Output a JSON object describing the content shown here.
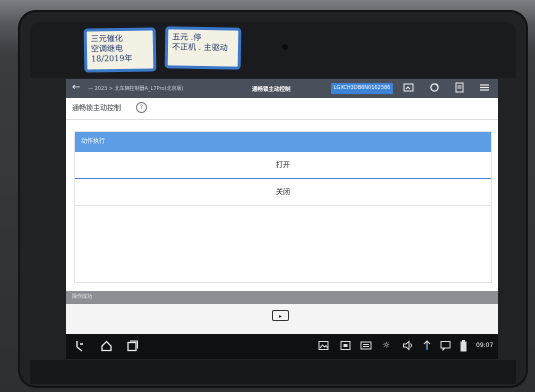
{
  "stickers": {
    "left": [
      "三元催化",
      "空调继电",
      "18/2019年"
    ],
    "right": [
      "五元 .停",
      "不正机 . 主驱动"
    ]
  },
  "app_bar": {
    "back_icon": "arrow-left-icon",
    "breadcrumb": "— 2023 > 北车辆控制器A_L7Pro(北京版)",
    "title": "通畅锁主动控制",
    "vin": "LGXCH3DB6N0162386",
    "icons": [
      "screenshot-icon",
      "refresh-icon",
      "report-icon",
      "menu-icon"
    ]
  },
  "page": {
    "subtitle": "通畅锁主动控制",
    "help": "?"
  },
  "action_panel": {
    "header": "动作执行",
    "options": [
      "打开",
      "关闭"
    ]
  },
  "result": {
    "header": "操作成功",
    "run_button_icon": "play-icon"
  },
  "nav_bar": {
    "time": "09:07",
    "left_icons": [
      "diagnose-icon",
      "home-icon",
      "recent-apps-icon"
    ],
    "right_icons": [
      "gallery-icon",
      "screen-record-icon",
      "keyboard-icon",
      "brightness-icon",
      "volume-icon",
      "vci-icon",
      "message-icon",
      "battery-icon"
    ]
  },
  "colors": {
    "accent": "#3d83d8",
    "panel_header": "#5c9de6",
    "app_bar": "#4a4f5c"
  }
}
